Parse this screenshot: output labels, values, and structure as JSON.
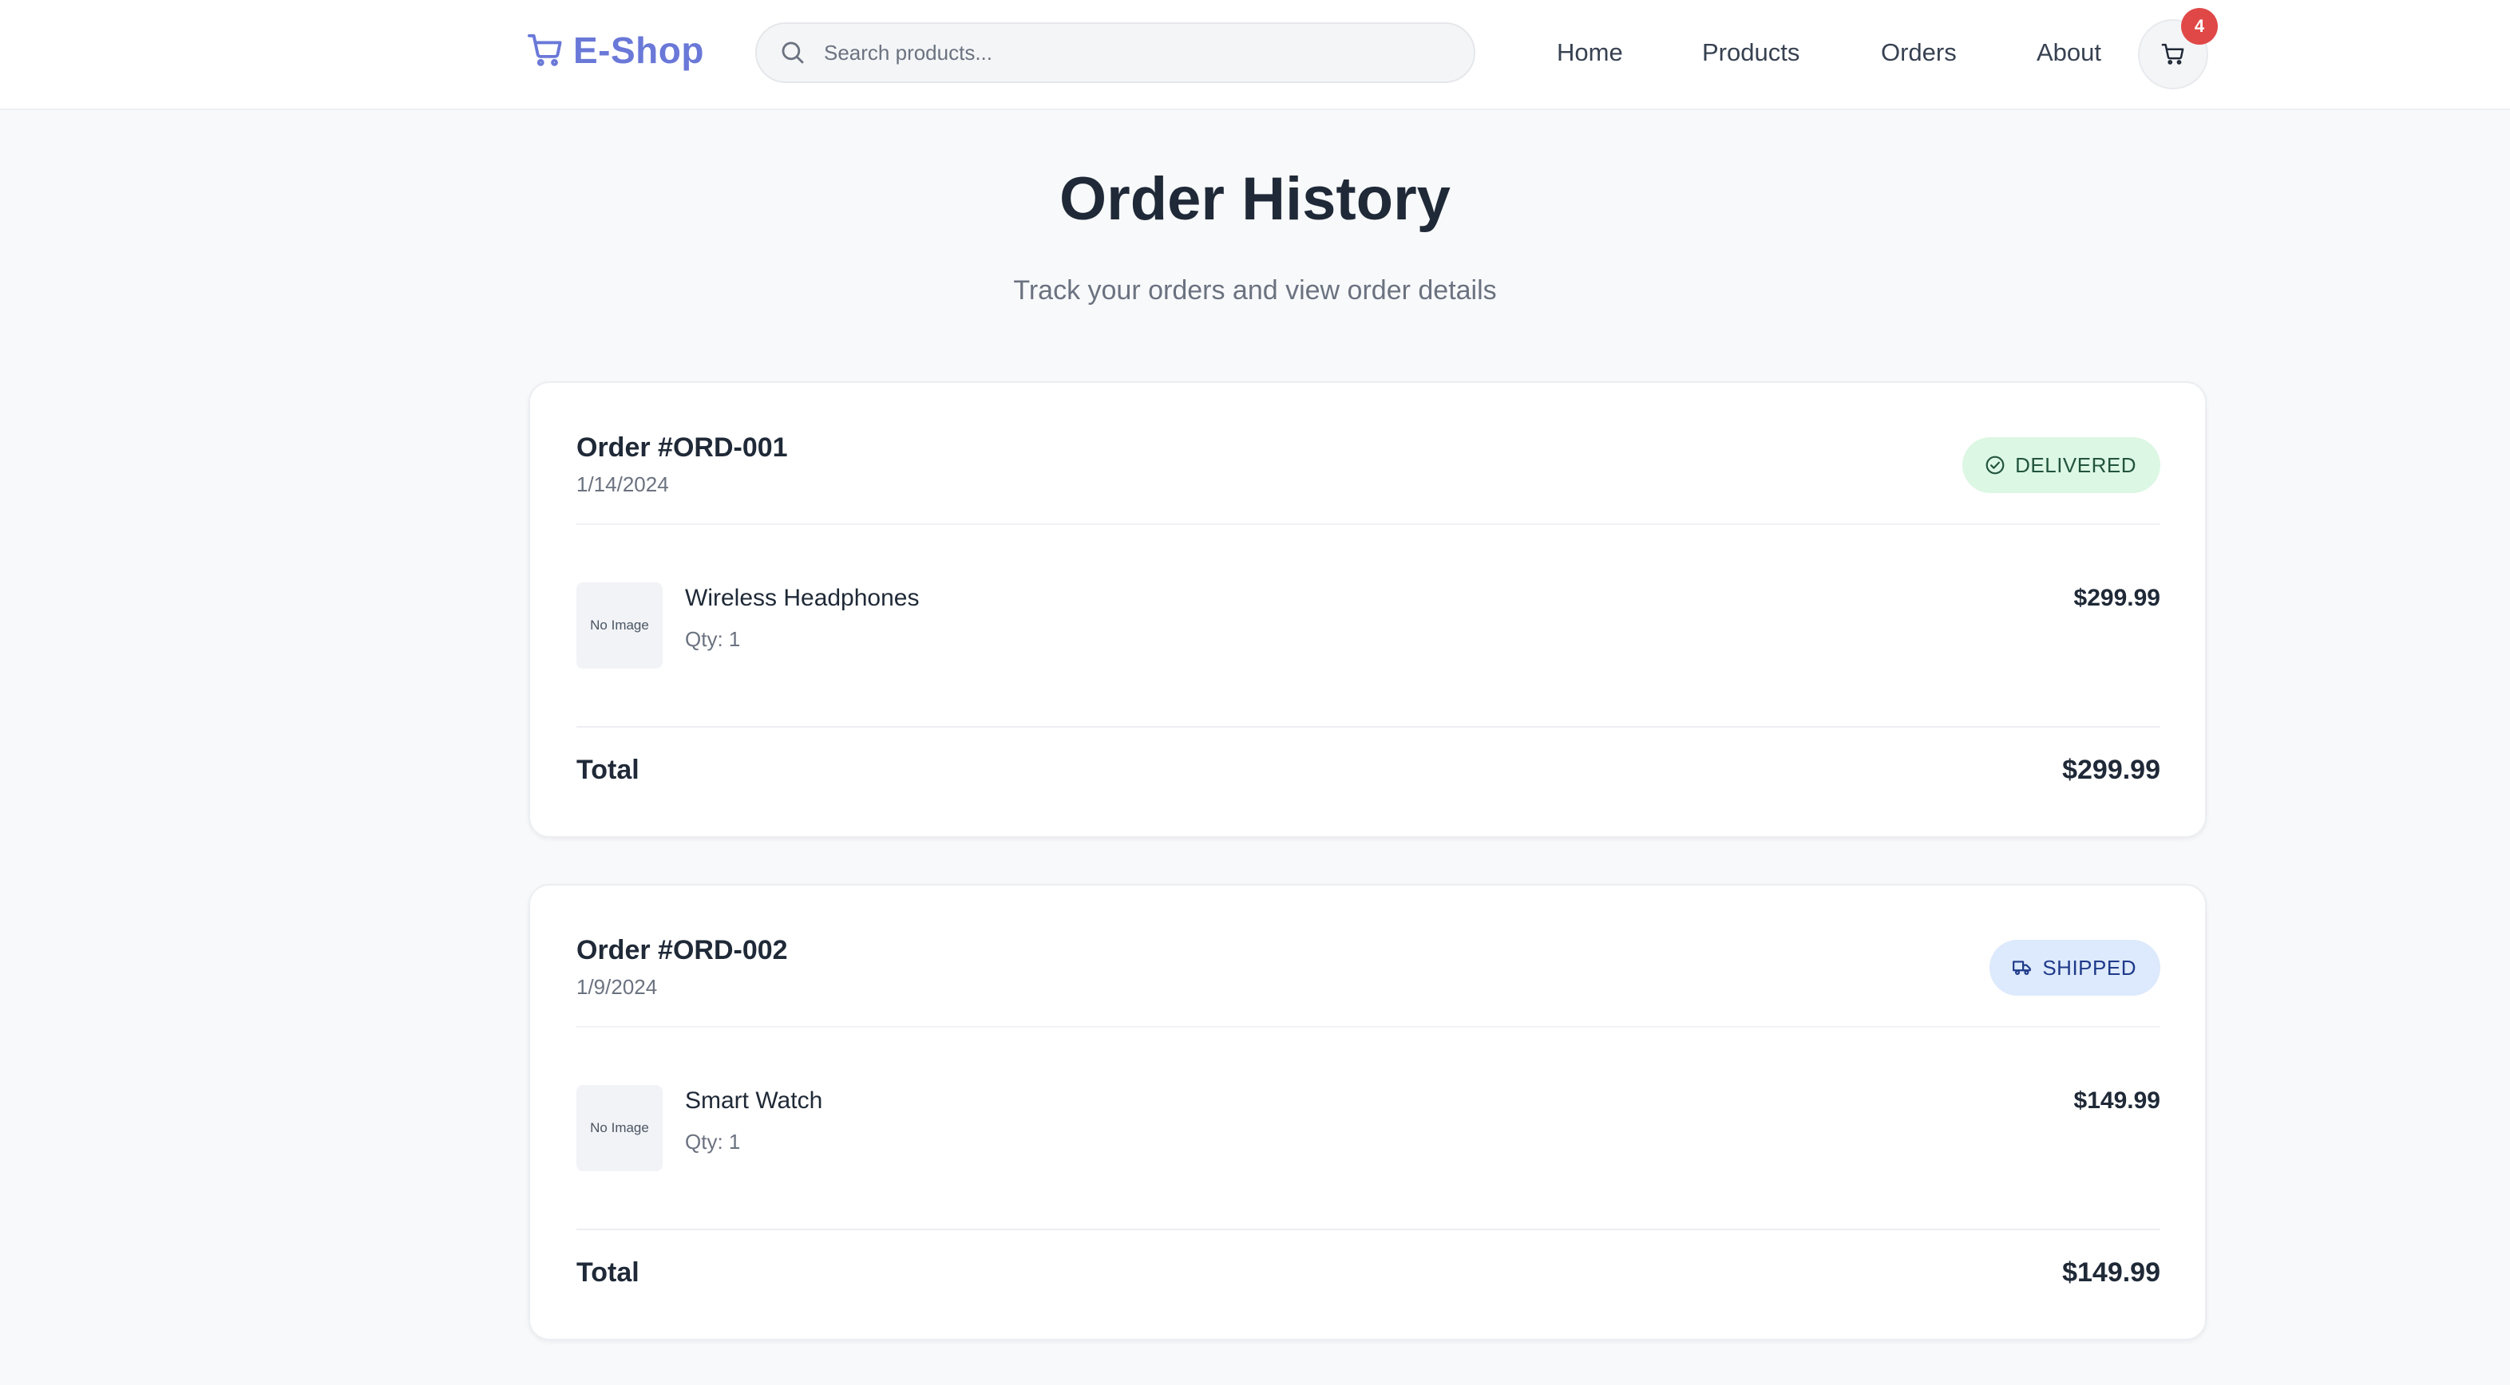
{
  "header": {
    "logo_text": "E-Shop",
    "logo_icon": "cart-icon",
    "search": {
      "placeholder": "Search products...",
      "value": "",
      "icon": "search-icon"
    },
    "nav": [
      "Home",
      "Products",
      "Orders",
      "About"
    ],
    "cart": {
      "icon": "cart-icon",
      "badge_count": "4"
    },
    "brand_color": "#6a78d8"
  },
  "main": {
    "title": "Order History",
    "subtitle": "Track your orders and view order details"
  },
  "orders": [
    {
      "id": "Order #ORD-001",
      "date": "1/14/2024",
      "status": "DELIVERED",
      "status_icon": "check-circle-icon",
      "status_color": "#22543d",
      "status_bg": "#dcf7e4",
      "item": {
        "thumbnail_text": "No Image",
        "name": "Wireless Headphones",
        "qty": "Qty: 1",
        "price": "$299.99"
      },
      "total_label": "Total",
      "total": "$299.99"
    },
    {
      "id": "Order #ORD-002",
      "date": "1/9/2024",
      "status": "SHIPPED",
      "status_icon": "truck-icon",
      "status_color": "#1e3a8a",
      "status_bg": "#dde9fc",
      "item": {
        "thumbnail_text": "No Image",
        "name": "Smart Watch",
        "qty": "Qty: 1",
        "price": "$149.99"
      },
      "total_label": "Total",
      "total": "$149.99"
    }
  ]
}
